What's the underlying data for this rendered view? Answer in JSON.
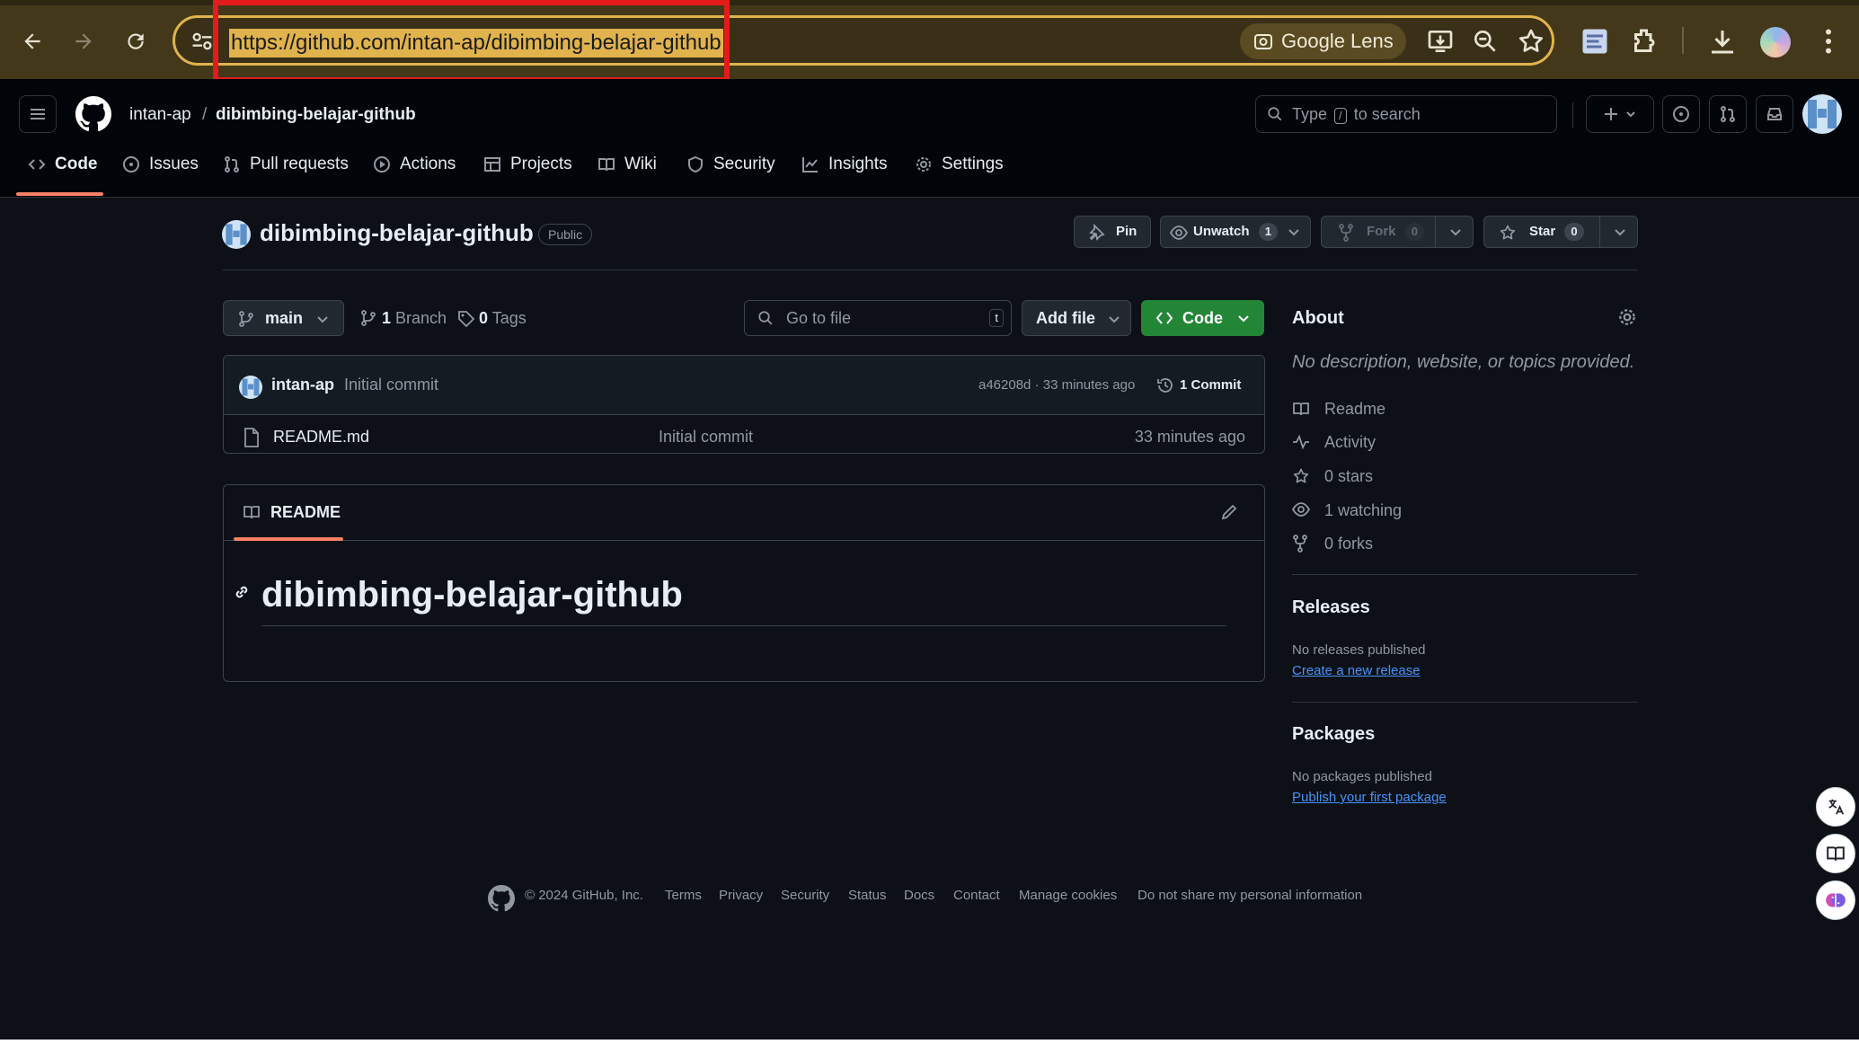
{
  "browser": {
    "url": "https://github.com/intan-ap/dibimbing-belajar-github",
    "lens_label": "Google Lens"
  },
  "header": {
    "owner": "intan-ap",
    "separator": "/",
    "repo": "dibimbing-belajar-github",
    "search_prefix": "Type",
    "search_key": "/",
    "search_suffix": "to search"
  },
  "tabs": [
    {
      "label": "Code",
      "icon": "code-icon"
    },
    {
      "label": "Issues",
      "icon": "issue-icon"
    },
    {
      "label": "Pull requests",
      "icon": "pull-request-icon"
    },
    {
      "label": "Actions",
      "icon": "play-icon"
    },
    {
      "label": "Projects",
      "icon": "table-icon"
    },
    {
      "label": "Wiki",
      "icon": "book-icon"
    },
    {
      "label": "Security",
      "icon": "shield-icon"
    },
    {
      "label": "Insights",
      "icon": "graph-icon"
    },
    {
      "label": "Settings",
      "icon": "gear-icon"
    }
  ],
  "repo": {
    "title": "dibimbing-belajar-github",
    "visibility": "Public",
    "pin_label": "Pin",
    "unwatch_label": "Unwatch",
    "watch_count": "1",
    "fork_label": "Fork",
    "fork_count": "0",
    "star_label": "Star",
    "star_count": "0"
  },
  "toolbar": {
    "branch": "main",
    "branch_count": "1",
    "branch_label": "Branch",
    "tag_count": "0",
    "tag_label": "Tags",
    "goto_placeholder": "Go to file",
    "goto_key": "t",
    "add_file": "Add file",
    "code": "Code"
  },
  "commit": {
    "author": "intan-ap",
    "message": "Initial commit",
    "hash_time": "a46208d · 33 minutes ago",
    "count_label": "1 Commit"
  },
  "files": [
    {
      "name": "README.md",
      "message": "Initial commit",
      "time": "33 minutes ago"
    }
  ],
  "readme": {
    "tab": "README",
    "heading": "dibimbing-belajar-github"
  },
  "about": {
    "title": "About",
    "description": "No description, website, or topics provided.",
    "readme": "Readme",
    "activity": "Activity",
    "stars": "0 stars",
    "watching": "1 watching",
    "forks": "0 forks"
  },
  "releases": {
    "title": "Releases",
    "none": "No releases published",
    "create": "Create a new release"
  },
  "packages": {
    "title": "Packages",
    "none": "No packages published",
    "publish": "Publish your first package"
  },
  "footer": {
    "copyright": "© 2024 GitHub, Inc.",
    "links": [
      "Terms",
      "Privacy",
      "Security",
      "Status",
      "Docs",
      "Contact",
      "Manage cookies",
      "Do not share my personal information"
    ]
  }
}
